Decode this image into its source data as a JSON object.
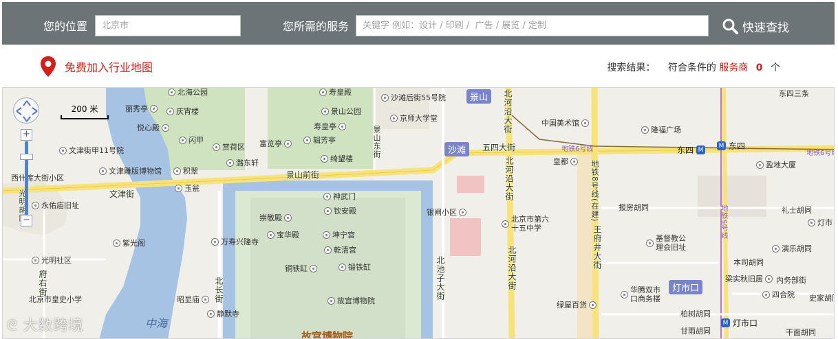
{
  "header": {
    "location_label": "您的位置",
    "location_placeholder": "北京市",
    "service_label": "您所需的服务",
    "service_placeholder": "关键字 例如：设计 / 印刷 /  广告 / 展览 / 定制",
    "search_button": "快速查找"
  },
  "toolbar": {
    "join_label": "免费加入行业地图",
    "result_prefix": "搜索结果：",
    "result_mid": "符合条件的",
    "result_link": "服务商",
    "result_count": "0",
    "result_unit": "个"
  },
  "map": {
    "scale_label": "200 米",
    "watermark": "大数跨境",
    "areas": {
      "zhonghai": "中海",
      "gugong": "故宫博物院"
    },
    "roads": {
      "wenjin": "文津街",
      "jingshan_front": "景山前街",
      "wusi": "五四大街",
      "beiheyan_top": "北河沿大街",
      "beiheyan_mid": "北河沿大街",
      "beiheyan_bot": "北河沿大街",
      "wangfujing": "王府井大街",
      "beichizi": "北池子大街",
      "beichang": "北长街",
      "jingshan_east": "景山东街",
      "fuyou": "府右街",
      "guangming": "光明胡同",
      "subway8": "地铁8号线(在建)"
    },
    "badges": {
      "jingshan": "景山",
      "shatan": "沙滩",
      "dengshikou": "灯市口"
    },
    "subways": {
      "dongsi_a": "东四",
      "dongsi_b": "东四",
      "dengshikou": "灯市口"
    },
    "lines": {
      "line6_a": "地铁6号线",
      "line6_b": "地铁6号线",
      "line5": "地铁5号线"
    },
    "pois": {
      "beihai": "北海公园",
      "shouhuangdian": "寿皇殿",
      "shatan55": "沙滩后街55号院",
      "meishuguan": "中国美术馆",
      "dongsisantiao": "东四三条",
      "lixiu": "丽秀亭",
      "qingxiao": "庆宵楼",
      "jingshanpark": "景山公园",
      "jingshi": "京师大学堂",
      "longfu": "隆福广场",
      "yuexin": "悦心殿",
      "shuhuang": "寿皇亭",
      "shanzhen": "闪甲",
      "shangqin": "赏荷区",
      "fushang": "富览亭",
      "jifang": "辑芳亭",
      "wenjin11": "文津街甲11号院",
      "qilu": "绮望楼",
      "huangdu": "皇都",
      "gaidi": "盈地大厦",
      "wenjinpub": "文津雕版博物馆",
      "zhinv": "积翠",
      "xichu": "西什库大街小区",
      "shuiqi": "潞东轩",
      "yuweng": "玉瓮",
      "shenwu": "神武门",
      "qinan": "钦安殿",
      "yinhe": "银闸小区",
      "boshu": "北京市第六十五中学",
      "baofang": "报房胡同",
      "lishi": "礼士胡同",
      "dengtou": "灯市",
      "yongyou": "永佑庙旧址",
      "chongjing": "崇敬殿",
      "baohua": "宝华殿",
      "kunning": "坤宁宫",
      "jidujiao": "基督教公理会旧址",
      "yanle": "演乐胡同",
      "ziguang": "紫光阁",
      "wanshou": "万寿兴隆寺",
      "qianqing": "乾清宫",
      "guangming": "光明社区",
      "tongtie": "铜铁缸",
      "mianjuan": "锻铁缸",
      "huateng": "华腾双市口商务楼",
      "beijingxiao": "北京市皇史小学",
      "benchi": "本司胡同",
      "liangshi": "梁实秋旧居",
      "neiwu": "内务部街",
      "zhaopian": "昭显庙",
      "gugongmuseum": "故宫博物院",
      "lvwu": "绿屋百货",
      "sihe": "四合院",
      "shijia": "史家胡同",
      "jingmo": "静默寺",
      "boyi": "柏树胡同",
      "ganyu": "甘雨胡同",
      "ganmian": "干面胡同"
    }
  }
}
